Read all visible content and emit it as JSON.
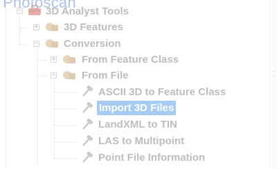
{
  "header": {
    "title": "Photoscan"
  },
  "tree": {
    "root": {
      "label": "3D Analyst Tools",
      "icon": "toolbox-icon",
      "expander": "−"
    },
    "features": {
      "label": "3D Features",
      "icon": "toolset-icon",
      "expander": "+"
    },
    "conversion": {
      "label": "Conversion",
      "icon": "toolset-icon",
      "expander": "−"
    },
    "from_feature_class": {
      "label": "From Feature Class",
      "icon": "toolset-icon",
      "expander": "+"
    },
    "from_file": {
      "label": "From File",
      "icon": "toolset-icon",
      "expander": "−"
    },
    "tools": [
      {
        "label": "ASCII 3D to Feature Class",
        "icon": "hammer-icon",
        "selected": false
      },
      {
        "label": "Import 3D Files",
        "icon": "hammer-icon",
        "selected": true
      },
      {
        "label": "LandXML to TIN",
        "icon": "hammer-icon",
        "selected": false
      },
      {
        "label": "LAS to Multipoint",
        "icon": "hammer-icon",
        "selected": false
      },
      {
        "label": "Point File Information",
        "icon": "hammer-icon",
        "selected": false
      }
    ]
  },
  "colors": {
    "selection": "#3a8ee6",
    "toolbox_red": "#c84a3a",
    "toolset_tan": "#c9a06a",
    "hammer_gray": "#8a8a8a"
  }
}
